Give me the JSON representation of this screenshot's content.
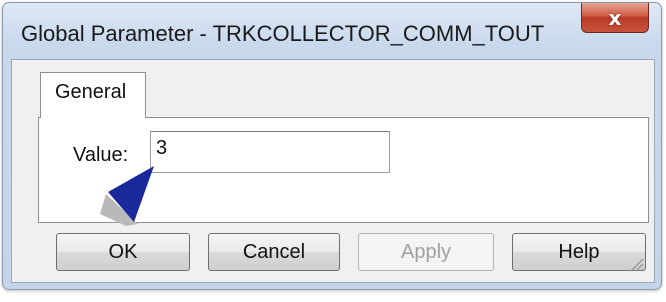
{
  "window": {
    "title": "Global Parameter - TRKCOLLECTOR_COMM_TOUT",
    "close_glyph": "x"
  },
  "tabs": [
    {
      "label": "General",
      "selected": true
    }
  ],
  "form": {
    "value_label": "Value:",
    "value": "3"
  },
  "buttons": {
    "ok": "OK",
    "cancel": "Cancel",
    "apply": "Apply",
    "apply_disabled": true,
    "help": "Help"
  },
  "colors": {
    "pointer_arrow": "#1a2a9c",
    "close_button": "#c94a33",
    "window_frame": "#c9d9ed"
  },
  "icons": {
    "close": "close-icon",
    "pointer": "pointer-arrow-icon",
    "grip": "resize-grip-icon"
  }
}
